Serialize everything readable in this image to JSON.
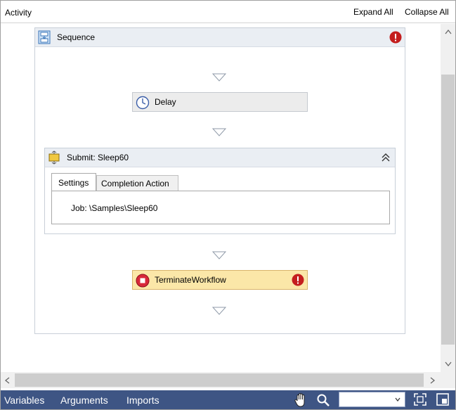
{
  "topbar": {
    "title": "Activity",
    "expand_all": "Expand All",
    "collapse_all": "Collapse All"
  },
  "sequence": {
    "label": "Sequence",
    "has_error": true
  },
  "delay": {
    "label": "Delay"
  },
  "submit": {
    "label": "Submit: Sleep60",
    "tabs": [
      "Settings",
      "Completion Action"
    ],
    "job_label": "Job: \\Samples\\Sleep60"
  },
  "terminate": {
    "label": "TerminateWorkflow",
    "has_error": true
  },
  "bottombar": {
    "variables": "Variables",
    "arguments": "Arguments",
    "imports": "Imports",
    "zoom_value": ""
  },
  "colors": {
    "bottombar_bg": "#3e5584",
    "error_red": "#c41e1e",
    "terminate_bg": "#fbe7a8",
    "header_bg": "#eaeef3"
  },
  "icons": {
    "sequence": "sequence-icon",
    "delay": "clock-icon",
    "submit": "submit-job-icon",
    "terminate": "stop-icon",
    "error": "error-icon",
    "hand": "hand-pan-icon",
    "search": "magnifier-icon",
    "fit": "fit-to-screen-icon",
    "overview": "overview-map-icon"
  }
}
